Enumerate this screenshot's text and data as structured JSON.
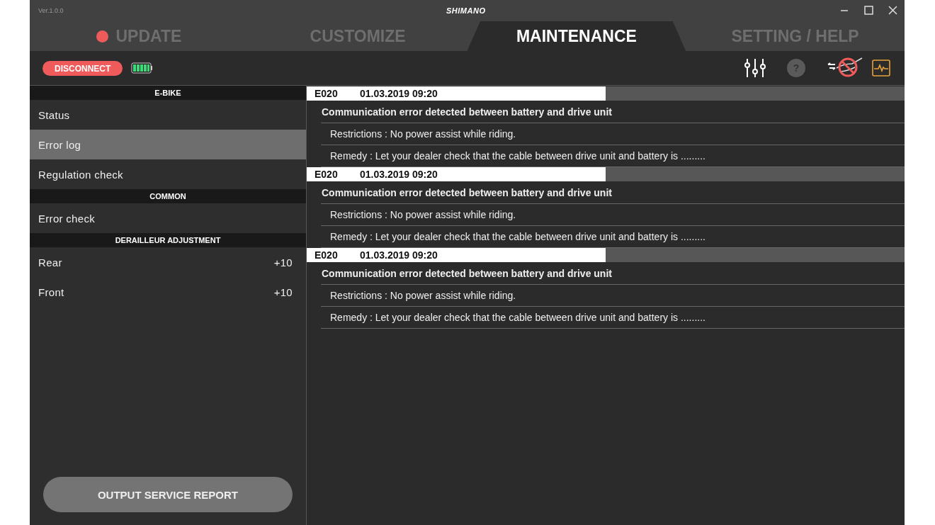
{
  "window": {
    "version": "Ver.1.0.0",
    "brand": "SHIMANO"
  },
  "tabs": [
    {
      "label": "UPDATE",
      "selected": false,
      "alert": true
    },
    {
      "label": "CUSTOMIZE",
      "selected": false,
      "alert": false
    },
    {
      "label": "MAINTENANCE",
      "selected": true,
      "alert": false
    },
    {
      "label": "SETTING / HELP",
      "selected": false,
      "alert": false
    }
  ],
  "toolbar": {
    "disconnect": "DISCONNECT",
    "help": "?"
  },
  "sidebar": {
    "sections": [
      {
        "title": "E-BIKE",
        "items": [
          {
            "label": "Status",
            "selected": false
          },
          {
            "label": "Error log",
            "selected": true
          },
          {
            "label": "Regulation check",
            "selected": false
          }
        ]
      },
      {
        "title": "COMMON",
        "items": [
          {
            "label": "Error check",
            "selected": false
          }
        ]
      },
      {
        "title": "DERAILLEUR ADJUSTMENT",
        "items": [
          {
            "label": "Rear",
            "value": "+10",
            "selected": false
          },
          {
            "label": "Front",
            "value": "+10",
            "selected": false
          }
        ]
      }
    ],
    "report_button": "OUTPUT SERVICE REPORT"
  },
  "errors": [
    {
      "code": "E020",
      "date": "01.03.2019",
      "time": "09:20",
      "title": "Communication error detected between battery and drive unit",
      "restrictions": "Restrictions : No power assist while riding.",
      "remedy": "Remedy : Let your dealer check that the cable between drive unit and battery is ........."
    },
    {
      "code": "E020",
      "date": "01.03.2019",
      "time": "09:20",
      "title": "Communication error detected between battery and drive unit",
      "restrictions": "Restrictions : No power assist while riding.",
      "remedy": "Remedy : Let your dealer check that the cable between drive unit and battery is ........."
    },
    {
      "code": "E020",
      "date": "01.03.2019",
      "time": "09:20",
      "title": "Communication error detected between battery and drive unit",
      "restrictions": "Restrictions : No power assist while riding.",
      "remedy": "Remedy : Let your dealer check that the cable between drive unit and battery is ........."
    }
  ]
}
